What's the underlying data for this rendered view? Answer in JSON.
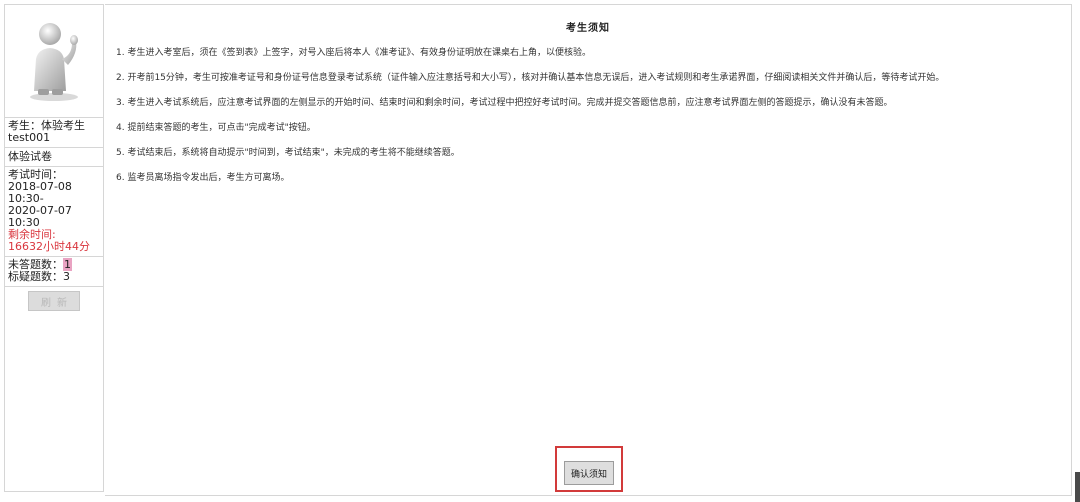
{
  "sidebar": {
    "candidate_label": "考生：体验考生",
    "candidate_id": "test001",
    "paper_name": "体验试卷",
    "exam_time_label": "考试时间：",
    "exam_start": "2018-07-08 10:30-",
    "exam_end": "2020-07-07 10:30",
    "remaining_label": "剩余时间:",
    "remaining_value": "16632小时44分",
    "unanswered_label": "未答题数：",
    "unanswered_value": "1",
    "flagged_label": "标疑题数：",
    "flagged_value": "3",
    "refresh_label": "刷新"
  },
  "notice": {
    "title": "考生须知",
    "items": [
      "1. 考生进入考室后，须在《签到表》上签字，对号入座后将本人《准考证》、有效身份证明放在课桌右上角，以便核验。",
      "2. 开考前15分钟，考生可按准考证号和身份证号信息登录考试系统（证件输入应注意括号和大小写），核对并确认基本信息无误后，进入考试规则和考生承诺界面，仔细阅读相关文件并确认后，等待考试开始。",
      "3. 考生进入考试系统后，应注意考试界面的左侧显示的开始时间、结束时间和剩余时间，考试过程中把控好考试时间。完成并提交答题信息前，应注意考试界面左侧的答题提示，确认没有未答题。",
      "4. 提前结束答题的考生，可点击\"完成考试\"按钮。",
      "5. 考试结束后，系统将自动提示\"时间到，考试结束\"，未完成的考生将不能继续答题。",
      "6. 监考员离场指令发出后，考生方可离场。"
    ]
  },
  "confirm_button_label": "确认须知",
  "colors": {
    "highlight_outline": "#d23a3a",
    "remaining_time": "#d9363e"
  },
  "icons": {
    "avatar": "person-thumbs-up-figure"
  }
}
